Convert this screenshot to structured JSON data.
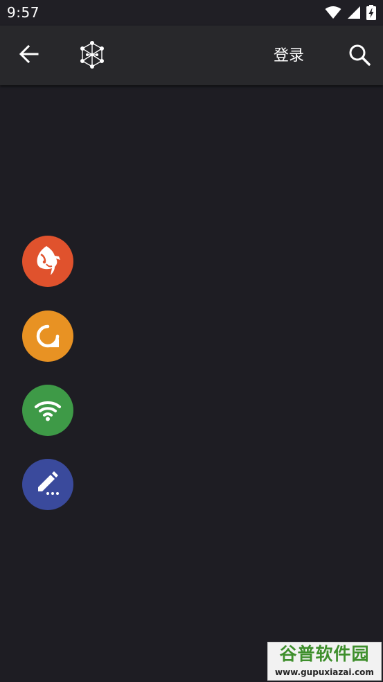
{
  "status_bar": {
    "time": "9:57",
    "icons": [
      "wifi-icon",
      "signal-icon",
      "battery-charging-icon"
    ]
  },
  "app_bar": {
    "back_icon": "arrow-back-icon",
    "logo_icon": "network-cube-logo",
    "login_label": "登录",
    "search_icon": "search-icon"
  },
  "app_buttons": [
    {
      "name": "fish-app",
      "icon": "fish-icon",
      "color": "#e0522d"
    },
    {
      "name": "refresh-app",
      "icon": "refresh-icon",
      "color": "#e89223"
    },
    {
      "name": "wifi-app",
      "icon": "wifi-icon",
      "color": "#3e9a47"
    },
    {
      "name": "edit-app",
      "icon": "pencil-icon",
      "color": "#3a4a9c"
    }
  ],
  "watermark": {
    "title": "谷普软件园",
    "url": "www.gupuxiazai.com"
  },
  "colors": {
    "background": "#1e1d23",
    "app_bar": "#28282b",
    "status_bar": "#201f25"
  }
}
